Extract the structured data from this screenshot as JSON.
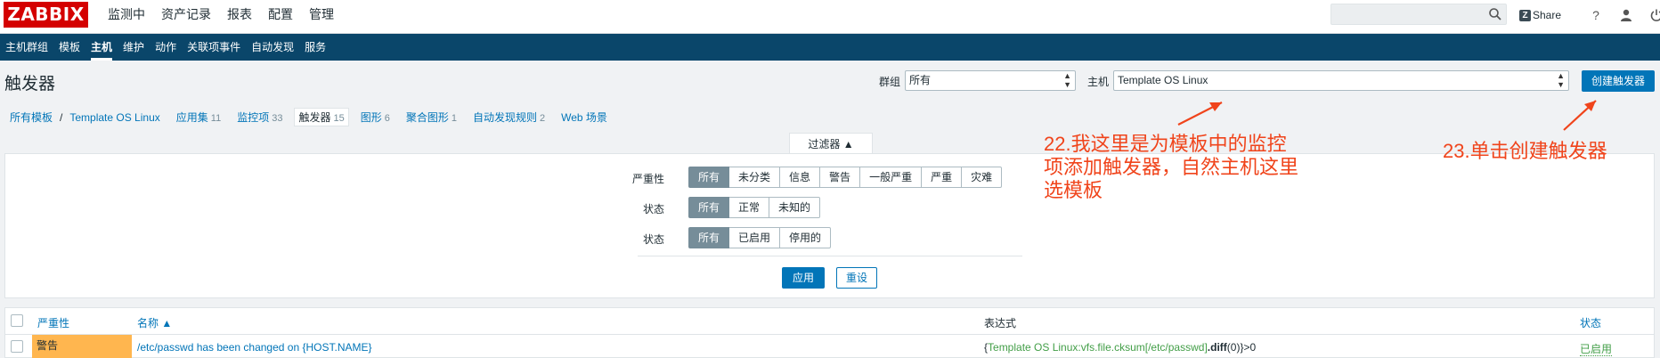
{
  "app": {
    "logo": "ZABBIX"
  },
  "topnav": [
    "监测中",
    "资产记录",
    "报表",
    "配置",
    "管理"
  ],
  "top_right": {
    "share": "Share",
    "help": "?"
  },
  "subnav": [
    "主机群组",
    "模板",
    "主机",
    "维护",
    "动作",
    "关联项事件",
    "自动发现",
    "服务"
  ],
  "header": {
    "title": "触发器",
    "group_label": "群组",
    "group_value": "所有",
    "host_label": "主机",
    "host_value": "Template OS Linux",
    "create_button": "创建触发器"
  },
  "breadcrumbs": {
    "all_templates": "所有模板",
    "template": "Template OS Linux",
    "tabs": [
      {
        "label": "应用集",
        "count": "11"
      },
      {
        "label": "监控项",
        "count": "33"
      },
      {
        "label": "触发器",
        "count": "15"
      },
      {
        "label": "图形",
        "count": "6"
      },
      {
        "label": "聚合图形",
        "count": "1"
      },
      {
        "label": "自动发现规则",
        "count": "2"
      },
      {
        "label": "Web 场景",
        "count": ""
      }
    ]
  },
  "filter": {
    "tab_label": "过滤器 ▲",
    "severity_label": "严重性",
    "severity_options": [
      "所有",
      "未分类",
      "信息",
      "警告",
      "一般严重",
      "严重",
      "灾难"
    ],
    "state_label": "状态",
    "state_options": [
      "所有",
      "正常",
      "未知的"
    ],
    "status_label": "状态",
    "status_options": [
      "所有",
      "已启用",
      "停用的"
    ],
    "apply": "应用",
    "reset": "重设"
  },
  "table": {
    "headers": {
      "severity": "严重性",
      "name": "名称 ▲",
      "expression": "表达式",
      "status": "状态"
    },
    "rows": [
      {
        "severity": "警告",
        "name": "/etc/passwd has been changed on {HOST.NAME}",
        "expr_open": "{",
        "expr_item": "Template OS Linux:vfs.file.cksum[/etc/passwd]",
        "expr_func": ".diff",
        "expr_close": "(0)}>0",
        "status": "已启用"
      }
    ]
  },
  "annotations": {
    "note22": "22.我这里是为模板中的监控项添加触发器，自然主机这里选模板",
    "note22_lines": [
      "22.我这里是为模板中的监控",
      "项添加触发器，自然主机这里",
      "选模板"
    ],
    "note23": "23.单击创建触发器"
  },
  "colors": {
    "accent": "#0275b8",
    "nav": "#0a466a",
    "warning": "#ffb64f",
    "annotation": "#f0441b",
    "logo": "#d40000"
  }
}
